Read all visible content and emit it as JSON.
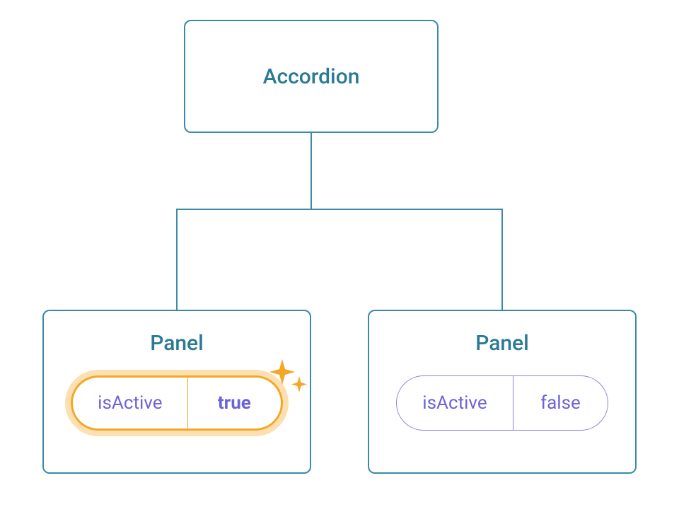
{
  "diagram": {
    "root": {
      "label": "Accordion"
    },
    "children": [
      {
        "label": "Panel",
        "prop": {
          "name": "isActive",
          "value": "true"
        },
        "highlighted": true
      },
      {
        "label": "Panel",
        "prop": {
          "name": "isActive",
          "value": "false"
        },
        "highlighted": false
      }
    ]
  }
}
